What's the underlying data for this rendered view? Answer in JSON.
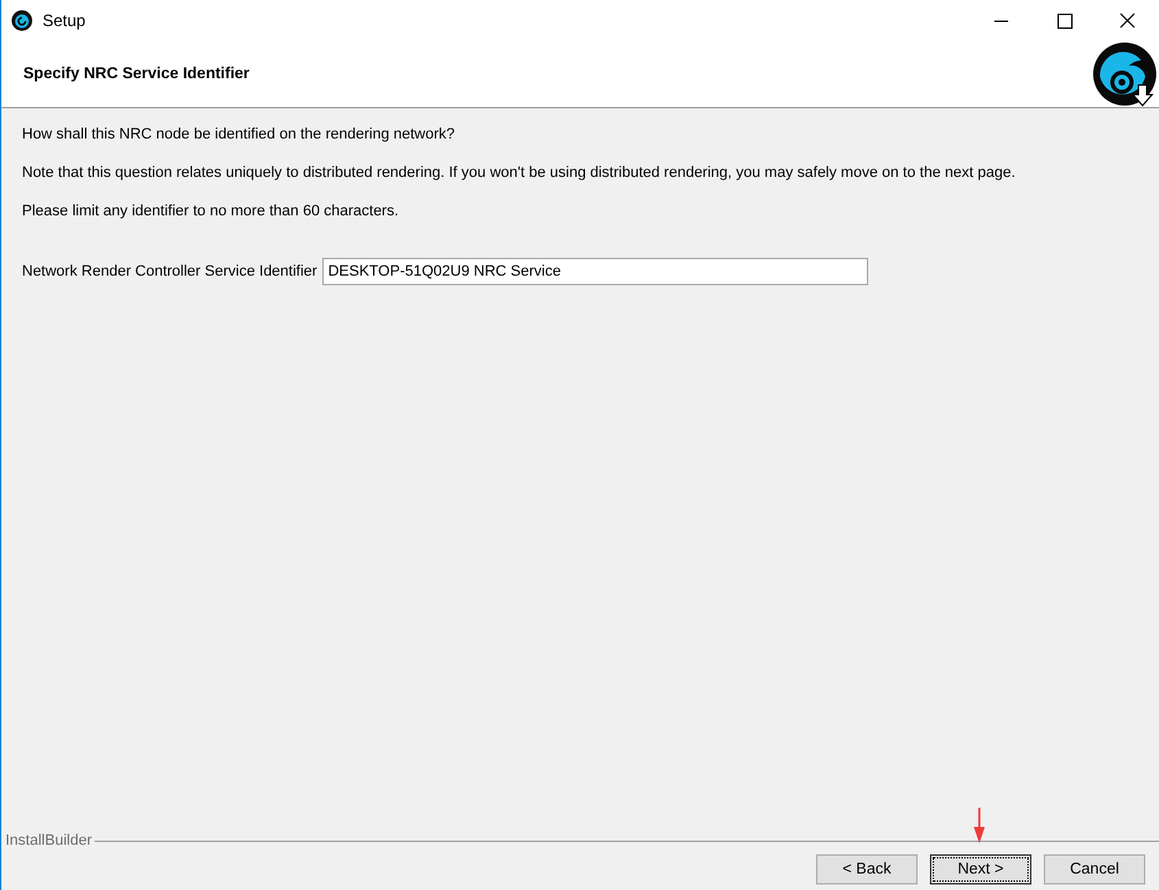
{
  "window": {
    "title": "Setup"
  },
  "header": {
    "title": "Specify NRC Service Identifier"
  },
  "paragraphs": [
    "How shall this NRC node be identified on the rendering network?",
    "Note that this question relates uniquely to distributed rendering.  If you won't be using distributed rendering, you may safely move on to the next page.",
    "Please limit any identifier to no more than 60 characters."
  ],
  "field": {
    "label": "Network Render Controller Service Identifier",
    "value": "DESKTOP-51Q02U9 NRC Service"
  },
  "footer": {
    "brand": "InstallBuilder"
  },
  "buttons": [
    {
      "label": "< Back",
      "default": false
    },
    {
      "label": "Next >",
      "default": true
    },
    {
      "label": "Cancel",
      "default": false
    }
  ]
}
